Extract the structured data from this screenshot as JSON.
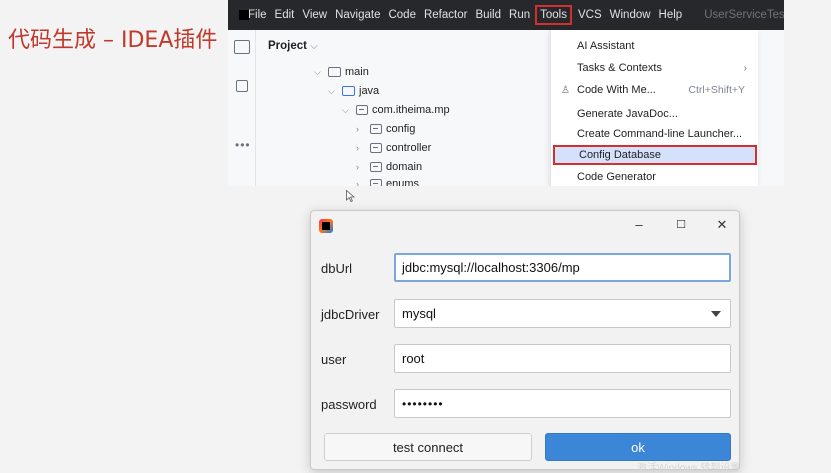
{
  "slide": {
    "title": "代码生成 – IDEA插件"
  },
  "ide": {
    "menu": [
      "File",
      "Edit",
      "View",
      "Navigate",
      "Code",
      "Refactor",
      "Build",
      "Run",
      "Tools",
      "VCS",
      "Window",
      "Help"
    ],
    "active_menu": "Tools",
    "file_title": "UserServiceTest.te",
    "project_label": "Project",
    "tree": [
      {
        "label": "main",
        "indent": 0,
        "open": true,
        "type": "folder"
      },
      {
        "label": "java",
        "indent": 1,
        "open": true,
        "type": "folder-blue"
      },
      {
        "label": "com.itheima.mp",
        "indent": 2,
        "open": true,
        "type": "package"
      },
      {
        "label": "config",
        "indent": 3,
        "open": false,
        "type": "package"
      },
      {
        "label": "controller",
        "indent": 3,
        "open": false,
        "type": "package"
      },
      {
        "label": "domain",
        "indent": 3,
        "open": false,
        "type": "package"
      },
      {
        "label": "enums",
        "indent": 3,
        "open": false,
        "type": "package"
      }
    ],
    "tools_menu": [
      {
        "label": "AI Assistant"
      },
      {
        "label": "Tasks & Contexts",
        "submenu": true
      },
      {
        "label": "Code With Me...",
        "shortcut": "Ctrl+Shift+Y",
        "icon": true
      },
      {
        "label": "Generate JavaDoc..."
      },
      {
        "label": "Create Command-line Launcher..."
      },
      {
        "label": "Config Database",
        "highlighted": true
      },
      {
        "label": "Code Generator"
      }
    ]
  },
  "dialog": {
    "controls": {
      "minimize": "–",
      "maximize": "☐",
      "close": "✕"
    },
    "fields": {
      "dbUrl": {
        "label": "dbUrl",
        "value": "jdbc:mysql://localhost:3306/mp"
      },
      "jdbcDriver": {
        "label": "jdbcDriver",
        "value": "mysql"
      },
      "user": {
        "label": "user",
        "value": "root"
      },
      "password": {
        "label": "password",
        "value": "••••••••"
      }
    },
    "test_button": "test connect",
    "ok_button": "ok",
    "watermark": "激活Windows 转到设置"
  }
}
